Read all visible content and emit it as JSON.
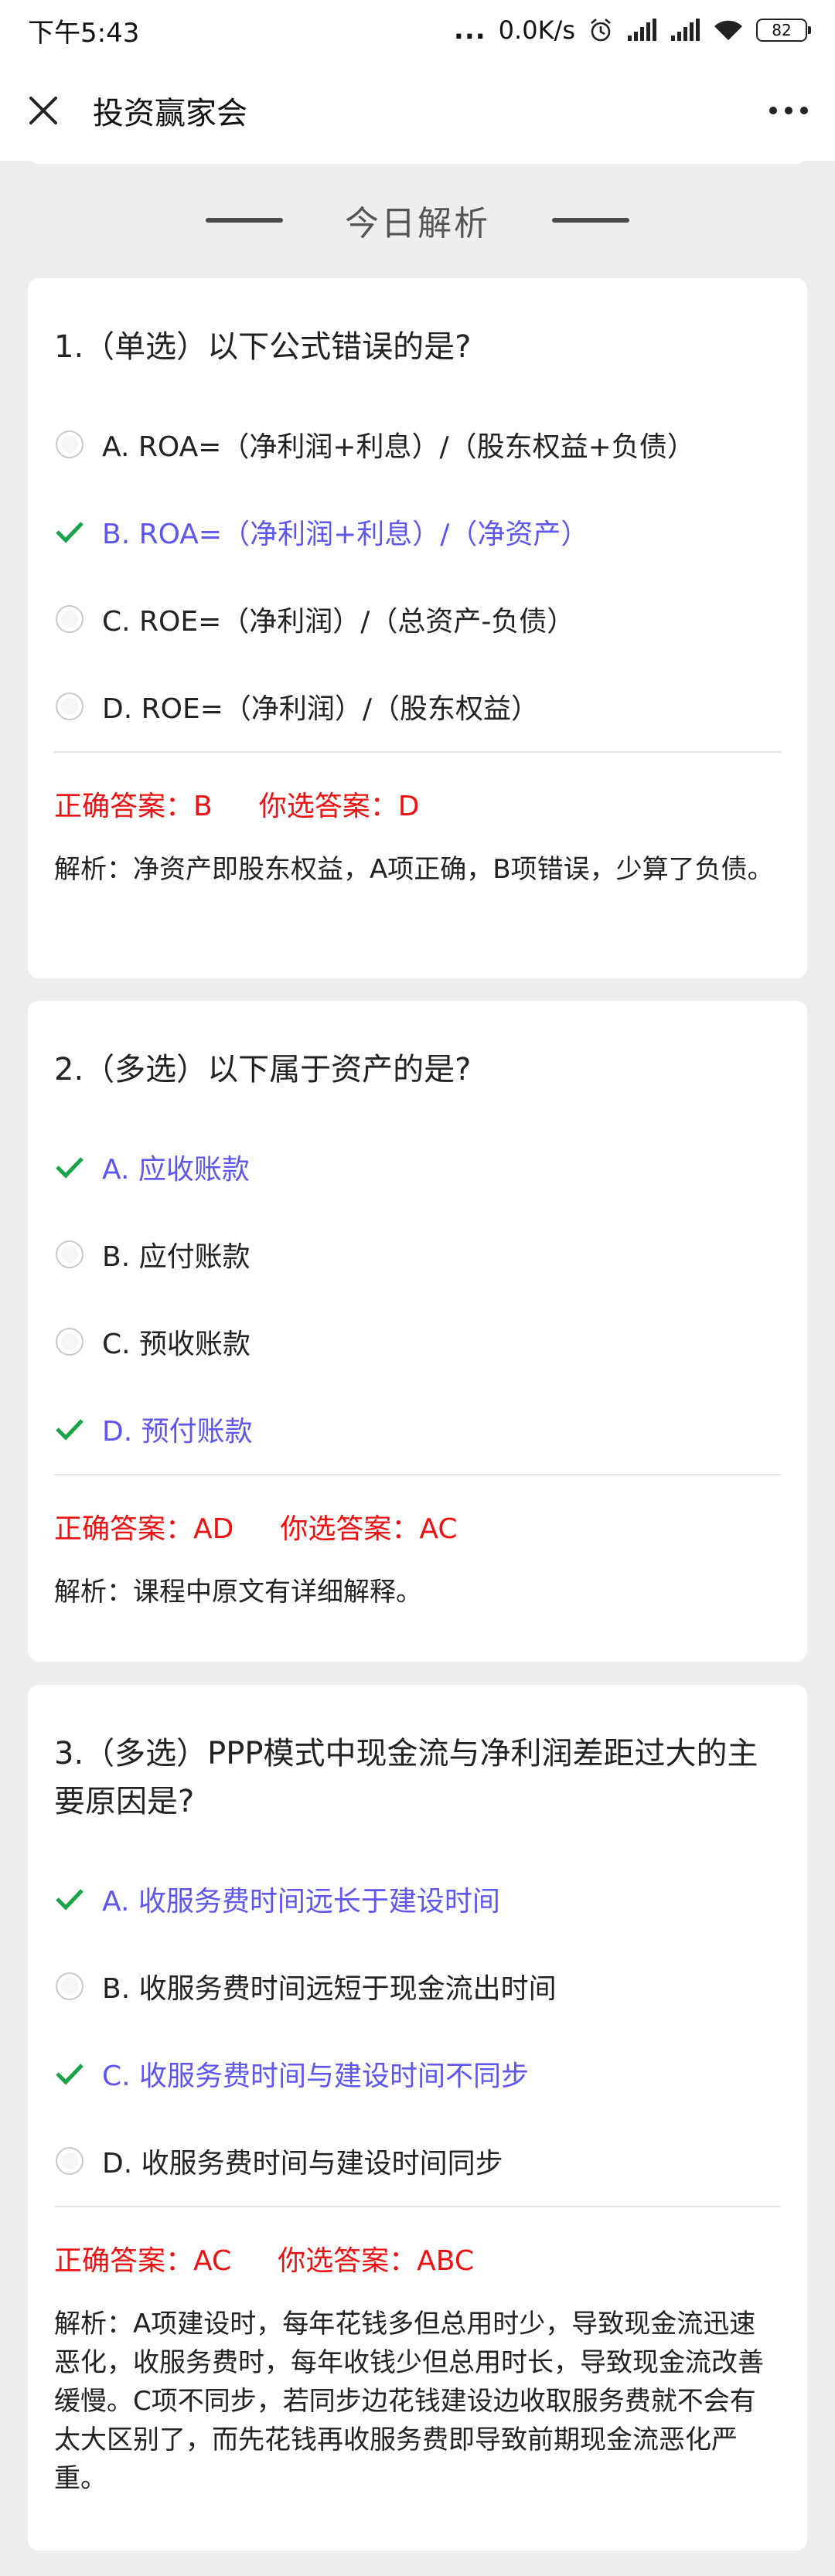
{
  "status_bar": {
    "time": "下午5:43",
    "dots": "...",
    "speed": "0.0K/s",
    "battery": "82"
  },
  "header": {
    "title": "投资赢家会"
  },
  "section": {
    "title": "今日解析"
  },
  "questions": [
    {
      "title": "1.（单选）以下公式错误的是?",
      "options": [
        {
          "text": "A. ROA=（净利润+利息）/（股东权益+负债）",
          "state": "radio"
        },
        {
          "text": "B. ROA=（净利润+利息）/（净资产）",
          "state": "correct"
        },
        {
          "text": "C. ROE=（净利润）/（总资产-负债）",
          "state": "radio"
        },
        {
          "text": "D. ROE=（净利润）/（股东权益）",
          "state": "radio"
        }
      ],
      "correct_answer": "正确答案：B",
      "your_answer": "你选答案：D",
      "explanation": "解析：净资产即股东权益，A项正确，B项错误，少算了负债。"
    },
    {
      "title": "2.（多选）以下属于资产的是?",
      "options": [
        {
          "text": "A. 应收账款",
          "state": "correct"
        },
        {
          "text": "B. 应付账款",
          "state": "radio"
        },
        {
          "text": "C. 预收账款",
          "state": "radio"
        },
        {
          "text": "D. 预付账款",
          "state": "correct"
        }
      ],
      "correct_answer": "正确答案：AD",
      "your_answer": "你选答案：AC",
      "explanation": "解析：课程中原文有详细解释。"
    },
    {
      "title": "3.（多选）PPP模式中现金流与净利润差距过大的主要原因是?",
      "options": [
        {
          "text": "A. 收服务费时间远长于建设时间",
          "state": "correct"
        },
        {
          "text": "B. 收服务费时间远短于现金流出时间",
          "state": "radio"
        },
        {
          "text": "C. 收服务费时间与建设时间不同步",
          "state": "correct"
        },
        {
          "text": "D. 收服务费时间与建设时间同步",
          "state": "radio"
        }
      ],
      "correct_answer": "正确答案：AC",
      "your_answer": "你选答案：ABC",
      "explanation": "解析：A项建设时，每年花钱多但总用时少，导致现金流迅速恶化，收服务费时，每年收钱少但总用时长，导致现金流改善缓慢。C项不同步，若同步边花钱建设边收取服务费就不会有太大区别了，而先花钱再收服务费即导致前期现金流恶化严重。"
    }
  ],
  "colors": {
    "correct_option": "#5d56f0",
    "check_mark": "#1aa34a",
    "answer_text": "#ee1111",
    "background": "#eeeeee"
  }
}
